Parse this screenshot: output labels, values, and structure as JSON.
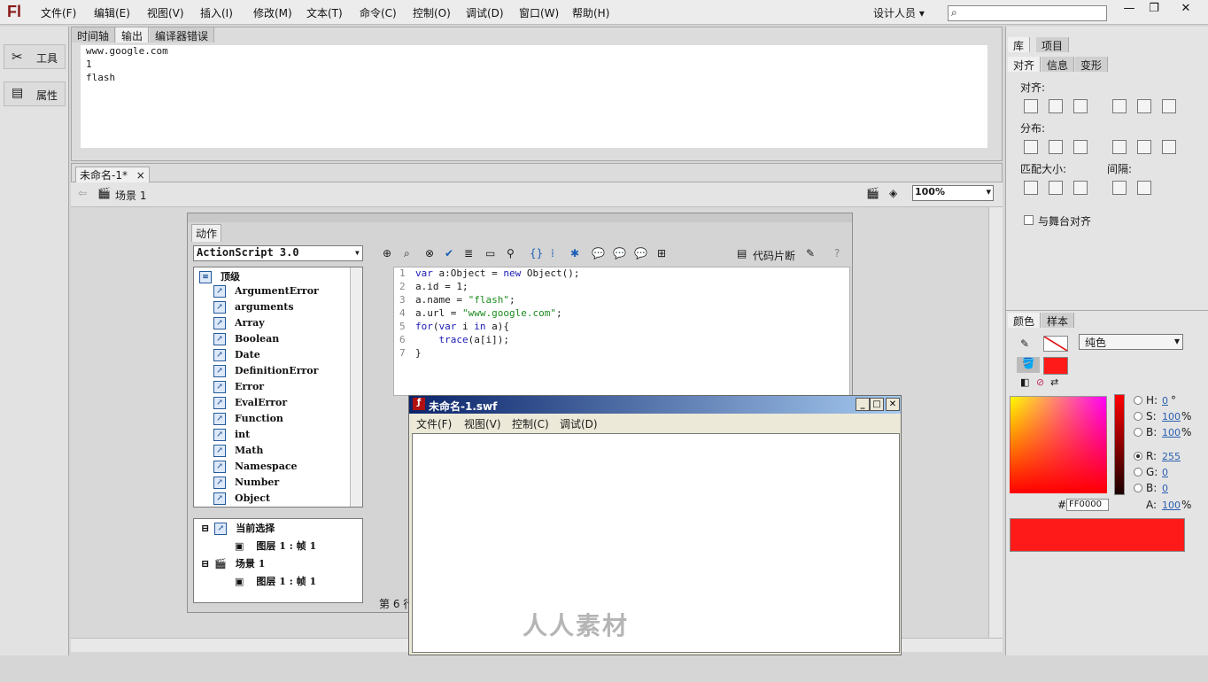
{
  "menubar": {
    "logo": "Fl",
    "items": [
      "文件(F)",
      "编辑(E)",
      "视图(V)",
      "插入(I)",
      "修改(M)",
      "文本(T)",
      "命令(C)",
      "控制(O)",
      "调试(D)",
      "窗口(W)",
      "帮助(H)"
    ],
    "workspace": "设计人员 ▾",
    "window_controls": [
      "—",
      "❐",
      "✕"
    ]
  },
  "lefttoolbar": {
    "tools_label": "工具",
    "properties_label": "属性"
  },
  "output_panel": {
    "tabs": [
      "时间轴",
      "输出",
      "编译器错误"
    ],
    "lines": [
      "www.google.com",
      "1",
      "flash"
    ]
  },
  "document": {
    "tab": "未命名-1*",
    "close": "×",
    "scene": "场景 1",
    "zoom": "100%"
  },
  "actions_panel": {
    "tab": "动作",
    "version": "ActionScript 3.0",
    "top_level": "顶级",
    "classes": [
      "ArgumentError",
      "arguments",
      "Array",
      "Boolean",
      "Date",
      "DefinitionError",
      "Error",
      "EvalError",
      "Function",
      "int",
      "Math",
      "Namespace",
      "Number",
      "Object"
    ],
    "tree": {
      "current_selection": "当前选择",
      "layer_frame_1": "图层 1 : 帧 1",
      "scene": "场景 1",
      "layer_frame_2": "图层 1 : 帧 1"
    },
    "snippets": "代码片断",
    "status": "第 6 行",
    "code_lines": [
      {
        "n": "1",
        "html": "var a:Object = new Object();"
      },
      {
        "n": "2",
        "html": "a.id = 1;"
      },
      {
        "n": "3",
        "html": "a.name = \"flash\";"
      },
      {
        "n": "4",
        "html": "a.url = \"www.google.com\";"
      },
      {
        "n": "5",
        "html": "for(var i in a){"
      },
      {
        "n": "6",
        "html": "    trace(a[i]);"
      },
      {
        "n": "7",
        "html": "}"
      }
    ]
  },
  "swf_window": {
    "title": "未命名-1.swf",
    "menu": [
      "文件(F)",
      "视图(V)",
      "控制(C)",
      "调试(D)"
    ]
  },
  "right_panel": {
    "top_tabs": [
      "库",
      "项目"
    ],
    "align_tabs": [
      "对齐",
      "信息",
      "变形"
    ],
    "align_label": "对齐:",
    "distribute_label": "分布:",
    "match_size_label": "匹配大小:",
    "spacing_label": "间隔:",
    "to_stage": "与舞台对齐",
    "color_tabs": [
      "颜色",
      "样本"
    ],
    "fill_type": "纯色",
    "h_label": "H:",
    "h_value": "0",
    "h_unit": "°",
    "s_label": "S:",
    "s_value": "100",
    "s_unit": "%",
    "b_label": "B:",
    "b_value": "100",
    "b_unit": "%",
    "r_label": "R:",
    "r_value": "255",
    "g_label": "G:",
    "g_value": "0",
    "bl_label": "B:",
    "bl_value": "0",
    "a_label": "A:",
    "a_value": "100",
    "a_unit": "%",
    "hex_label": "#",
    "hex_value": "FF0000",
    "color": "#ff1a1a"
  },
  "watermark": "人人素材"
}
